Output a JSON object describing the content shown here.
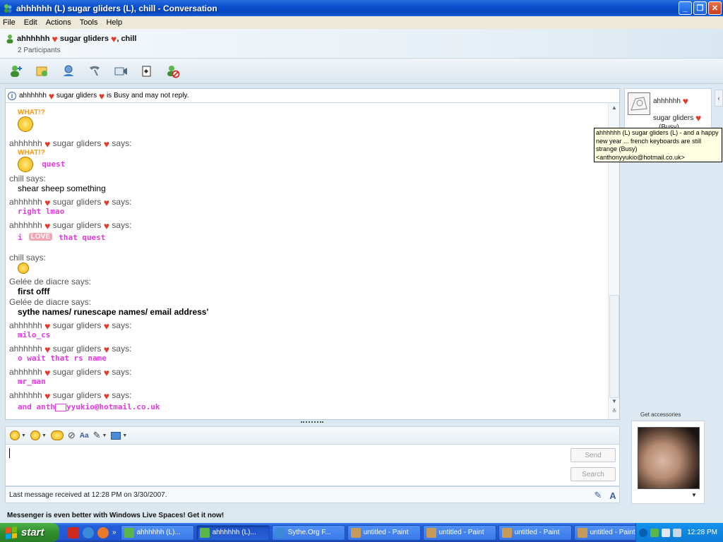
{
  "window": {
    "title": "ahhhhhh (L) sugar gliders (L), chill - Conversation",
    "buttons": [
      "_",
      "❐",
      "✕"
    ]
  },
  "menu": [
    "File",
    "Edit",
    "Actions",
    "Tools",
    "Help"
  ],
  "header": {
    "title_a": "ahhhhhh",
    "title_b": "sugar gliders",
    "title_c": ", chill",
    "participants": "2 Participants"
  },
  "toolbar": {
    "icons": [
      "invite-contact-icon",
      "send-files-icon",
      "video-call-icon",
      "call-icon",
      "activities-icon",
      "games-icon",
      "block-icon"
    ]
  },
  "busy_notice": {
    "name_a": "ahhhhhh",
    "name_b": "sugar gliders",
    "text": "is Busy and may not reply."
  },
  "messages": {
    "say_a": "ahhhhhh",
    "say_b": "sugar gliders",
    "says": "says:",
    "what_label": "WHAT!?",
    "quest": "quest",
    "chill_says": "chill says:",
    "shear": "shear sheep something",
    "right_lmao": "right lmao",
    "i": "i",
    "love_label": "LOVE",
    "that_quest": "that quest",
    "gelee_says": "Gelée de diacre says:",
    "first_offf": "first offf",
    "sythe_names": "sythe names/ runescape names/ email address'",
    "milo_cs": "milo_cs",
    "o_wait": "o wait that rs name",
    "mr_man": "mr_man",
    "and_anth": "and anth",
    "email_tail": "yyukio@hotmail.co.uk"
  },
  "compose": {
    "send": "Send",
    "search": "Search",
    "status": "Last message received at 12:28 PM on 3/30/2007."
  },
  "contact": {
    "name_a": "ahhhhhh",
    "name_b": "sugar gliders",
    "status": "(Busy)",
    "tooltip": "ahhhhhh (L) sugar gliders (L) - and a happy new year ... french keyboards are still strange (Busy) <anthonyyukio@hotmail.co.uk>"
  },
  "accessories": "Get accessories",
  "promo": "Messenger is even better with Windows Live Spaces! Get it now!",
  "taskbar": {
    "start": "start",
    "tasks": [
      {
        "label": "ahhhhhh (L)...",
        "active": false
      },
      {
        "label": "ahhhhhh (L)...",
        "active": true
      },
      {
        "label": "Sythe.Org F...",
        "active": false
      },
      {
        "label": "untitled - Paint",
        "active": false
      },
      {
        "label": "untitled - Paint",
        "active": false
      },
      {
        "label": "untitled - Paint",
        "active": false
      },
      {
        "label": "untitled - Paint",
        "active": false
      }
    ],
    "clock": "12:28 PM"
  },
  "colors": {
    "heart": "#e23b2a",
    "message_pink": "#e23be0",
    "titlebar_blue": "#0a4fcf"
  }
}
